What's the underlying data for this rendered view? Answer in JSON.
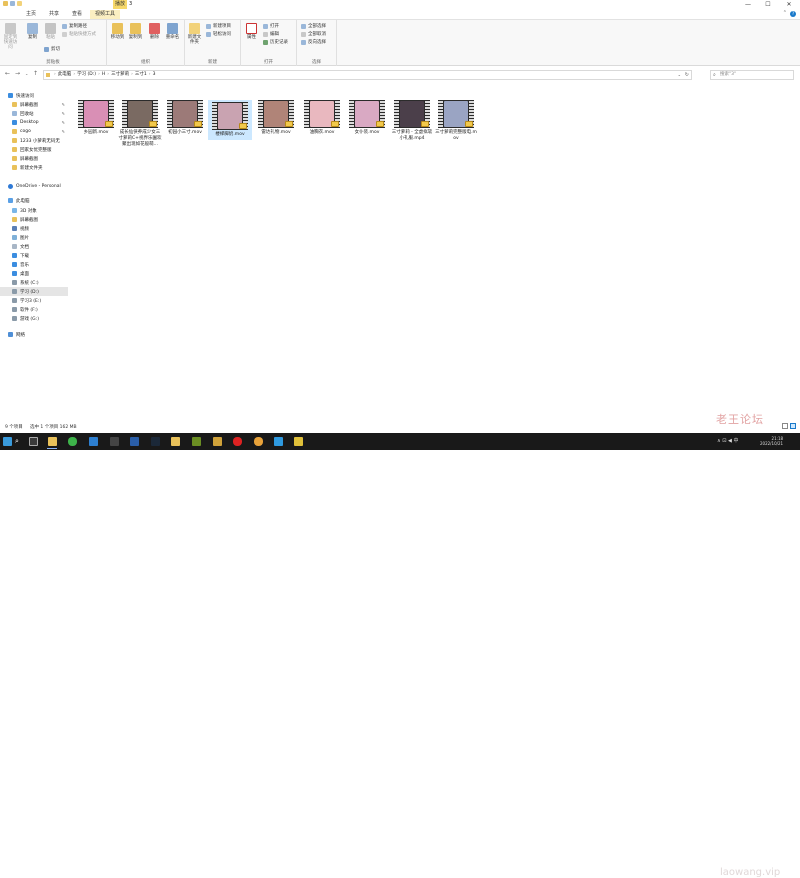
{
  "title_bar": {
    "context_tab": "播放",
    "window_title": "3",
    "controls": [
      "—",
      "☐",
      "✕"
    ]
  },
  "ribbon_tabs": [
    "文件",
    "主页",
    "共享",
    "查看",
    "视频工具"
  ],
  "ribbon": {
    "clipboard": {
      "pin": "固定到快速访问",
      "copy": "复制",
      "paste": "粘贴",
      "cut": "剪切",
      "copy_path": "复制路径",
      "paste_shortcut": "粘贴快捷方式",
      "label": "剪贴板"
    },
    "organize": {
      "move_to": "移动到",
      "copy_to": "复制到",
      "delete": "删除",
      "rename": "重命名",
      "label": "组织"
    },
    "new": {
      "new_folder": "新建文件夹",
      "new_item": "新建项目",
      "easy_access": "轻松访问",
      "label": "新建"
    },
    "open": {
      "properties": "属性",
      "open": "打开",
      "edit": "编辑",
      "history": "历史记录",
      "label": "打开"
    },
    "select": {
      "select_all": "全部选择",
      "select_none": "全部取消",
      "invert": "反向选择",
      "label": "选择"
    }
  },
  "address": {
    "breadcrumbs": [
      "此电脑",
      "学习 (D:)",
      "H",
      "三寸萝莉",
      "三寸1",
      "3"
    ],
    "search_placeholder": "搜索\"3\""
  },
  "nav_pane": {
    "quick_access": "快速访问",
    "quick_items": [
      "屏幕截图",
      "回收站",
      "Desktop",
      "cogo",
      "1233 小萝莉无码无",
      "回家女优完整版",
      "屏幕截图",
      "新建文件夹"
    ],
    "onedrive": "OneDrive - Personal",
    "this_pc": "此电脑",
    "pc_items": [
      "3D 对象",
      "屏幕截图",
      "视频",
      "图片",
      "文档",
      "下载",
      "音乐",
      "桌面",
      "系统 (C:)",
      "学习 (D:)",
      "学习3 (E:)",
      "软件 (F:)",
      "游戏 (G:)"
    ],
    "network": "网络"
  },
  "files": [
    {
      "name": "乡园新.mov",
      "color": "#d98fb5"
    },
    {
      "name": "成长仙侠养成少女三寸萝莉C+视界乐園欢聚出现如花般萌...",
      "color": "#7a6a62"
    },
    {
      "name": "初园小三寸.mov",
      "color": "#9c7a78"
    },
    {
      "name": "楼梯脚奶.mov",
      "color": "#c9a3b1"
    },
    {
      "name": "雷达礼物.mov",
      "color": "#b08478"
    },
    {
      "name": "油胸衣.mov",
      "color": "#e9b8bf"
    },
    {
      "name": "女仆装.mov",
      "color": "#d9a9c3"
    },
    {
      "name": "三寸萝莉 - 全虚拟软小礼服.mp4",
      "color": "#4b3f4a"
    },
    {
      "name": "三寸萝莉完整版电.mov",
      "color": "#9aa4c3"
    }
  ],
  "status": {
    "count": "9 个项目",
    "selected": "选中 1 个项目  162 MB"
  },
  "watermark": {
    "cn": "老王论坛",
    "url": "laowang.vip"
  },
  "clock": {
    "time": "21:18",
    "date": "2022/10/21"
  }
}
